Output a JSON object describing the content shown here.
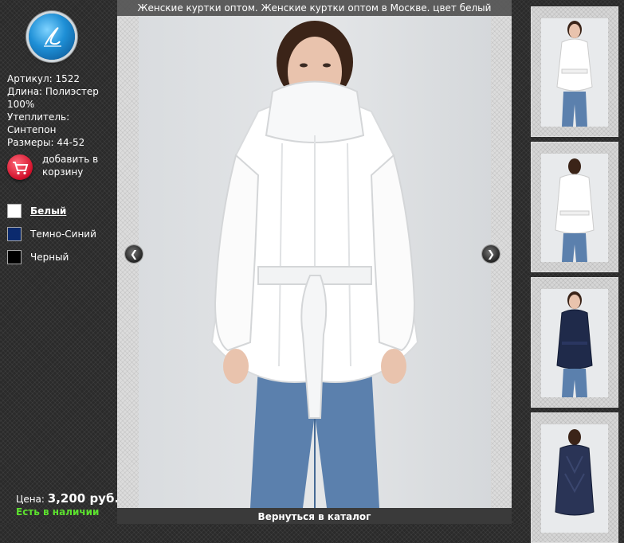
{
  "logo": {
    "monogram": "L"
  },
  "product": {
    "article": "Артикул: 1522",
    "length": "Длина: Полиэстер 100%",
    "insulation": "Утеплитель: Синтепон",
    "sizes": "Размеры: 44-52"
  },
  "cart": {
    "label": "добавить в корзину",
    "icon": "shopping-cart-icon"
  },
  "colors": [
    {
      "label": "Белый",
      "hex": "#ffffff",
      "selected": true
    },
    {
      "label": "Темно-Синий",
      "hex": "#0b2a6e",
      "selected": false
    },
    {
      "label": "Черный",
      "hex": "#000000",
      "selected": false
    }
  ],
  "price": {
    "label": "Цена:",
    "value": "3,200 руб."
  },
  "stock": "Есть в наличии",
  "main": {
    "title": "Женские куртки оптом. Женские куртки оптом в Москве. цвет белый",
    "back_link": "Вернуться в каталог",
    "prev_icon": "chevron-left-icon",
    "next_icon": "chevron-right-icon"
  },
  "thumbnails": [
    {
      "view": "white-front"
    },
    {
      "view": "white-back"
    },
    {
      "view": "navy-front"
    },
    {
      "view": "navy-back"
    }
  ],
  "accent_colors": {
    "stock": "#5ce02e",
    "cart": "#d0102a",
    "logo": "#1e8fd6"
  }
}
